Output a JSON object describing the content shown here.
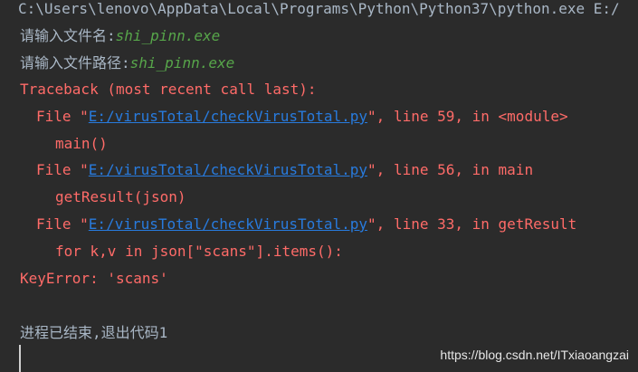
{
  "console": {
    "command_line": "C:\\Users\\lenovo\\AppData\\Local\\Programs\\Python\\Python37\\python.exe E:/",
    "prompt_filename": "请输入文件名:",
    "input_filename": "shi_pinn.exe",
    "prompt_filepath": "请输入文件路径:",
    "input_filepath": "shi_pinn.exe",
    "traceback_header": "Traceback (most recent call last):",
    "frames": [
      {
        "prefix": "File \"",
        "path": "E:/virusTotal/checkVirusTotal.py",
        "suffix": "\", line 59, in <module>",
        "code": "main()"
      },
      {
        "prefix": "File \"",
        "path": "E:/virusTotal/checkVirusTotal.py",
        "suffix": "\", line 56, in main",
        "code": "getResult(json)"
      },
      {
        "prefix": "File \"",
        "path": "E:/virusTotal/checkVirusTotal.py",
        "suffix": "\", line 33, in getResult",
        "code": "for k,v in json[\"scans\"].items():"
      }
    ],
    "error_line": "KeyError: 'scans'",
    "exit_message": "进程已结束,退出代码1"
  },
  "watermark": "https://blog.csdn.net/ITxiaoangzai",
  "colors": {
    "background": "#2b2b2b",
    "default_text": "#a9b7c6",
    "error_text": "#ff6b68",
    "input_text": "#57a64a",
    "link_text": "#287bde"
  }
}
